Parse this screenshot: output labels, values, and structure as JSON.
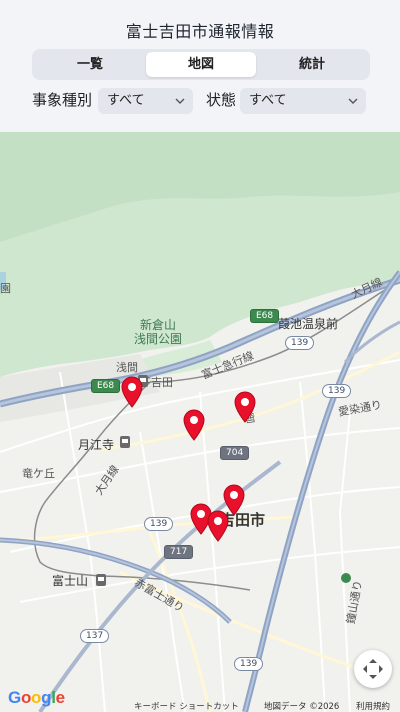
{
  "header": {
    "title": "富士吉田市通報情報",
    "tabs": [
      {
        "label": "一覧",
        "active": false
      },
      {
        "label": "地図",
        "active": true
      },
      {
        "label": "統計",
        "active": false
      }
    ],
    "filters": {
      "type_label": "事象種別",
      "type_value": "すべて",
      "status_label": "状態",
      "status_value": "すべて"
    }
  },
  "map": {
    "labels": {
      "shinkurayama": "新倉山\n浅間公園",
      "sengen": "浅間",
      "shimoyoshida": "下吉田",
      "fujikyu": "富士急行線",
      "kaikeonsen": "葭池温泉前",
      "otsuki_line_top": "大月線",
      "gekkoji": "月江寺",
      "ryugaoka": "竜ケ丘",
      "otsuki_line": "大月線",
      "city": "吉田市",
      "aizome": "愛染通り",
      "fujisan": "富士山",
      "akafuji": "赤富士通り",
      "kamagami": "鐘山通り",
      "kaikeda": "御",
      "left_edge": "園"
    },
    "road_shields": {
      "e68_top": "E68",
      "e68_left": "E68",
      "r139_a": "139",
      "r139_b": "139",
      "r139_c": "139",
      "r139_d": "139",
      "r704": "704",
      "r717": "717",
      "r137": "137"
    },
    "marker_count": 6,
    "attribution": {
      "logo": "Google",
      "keyboard": "キーボード ショートカット",
      "data": "地図データ ©2026",
      "terms": "利用規約"
    }
  },
  "colors": {
    "marker": "#e8102a",
    "forest": "#cfe6cf",
    "highway": "#8fa3c5",
    "water": "#aad3df"
  }
}
